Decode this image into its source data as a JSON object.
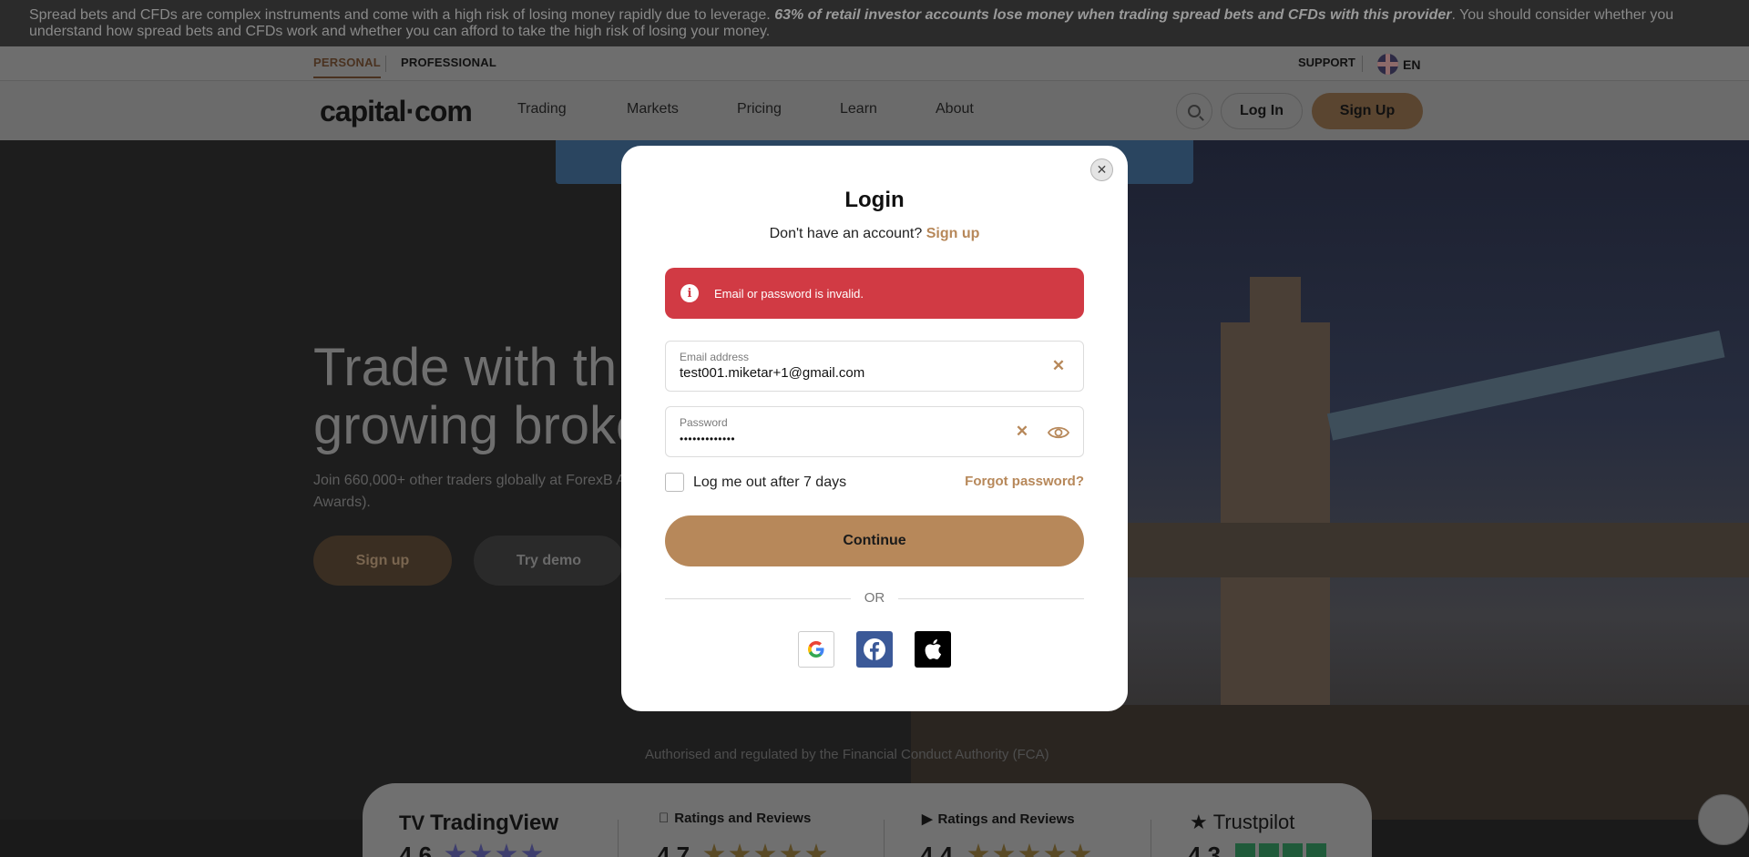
{
  "risk_banner": {
    "text_start": "Spread bets and CFDs are complex instruments and come with a high risk of losing money rapidly due to leverage. ",
    "text_bold": "63% of retail investor accounts lose money when trading spread bets and CFDs with this provider",
    "text_end": ". You should consider whether you understand how spread bets and CFDs work and whether you can afford to take the high risk of losing your money."
  },
  "subnav": {
    "personal": "PERSONAL",
    "professional": "PROFESSIONAL",
    "support": "SUPPORT",
    "language": "EN"
  },
  "nav": {
    "logo": "capital·com",
    "links": [
      "Trading",
      "Markets",
      "Pricing",
      "Learn",
      "About"
    ],
    "login": "Log In",
    "signup": "Sign Up"
  },
  "hero": {
    "title_line1": "Trade with th",
    "title_line2": "growing broke",
    "subtitle": "Join 660,000+ other traders globally at ForexB Annual Awards).",
    "signup": "Sign up",
    "demo": "Try demo",
    "regulation": "Authorised and regulated by the Financial Conduct Authority (FCA)"
  },
  "ratings": {
    "tradingview": "TradingView",
    "apple": "Ratings and Reviews",
    "google": "Ratings and Reviews",
    "trustpilot": "Trustpilot",
    "scores": [
      "4.6",
      "4.7",
      "4.4",
      "4.3"
    ]
  },
  "modal": {
    "title": "Login",
    "no_account": "Don't have an account?",
    "signup_link": "Sign up",
    "error": "Email or password is invalid.",
    "email_label": "Email address",
    "email_value": "test001.miketar+1@gmail.com",
    "password_label": "Password",
    "password_value": "•••••••••••••",
    "remember": "Log me out after 7 days",
    "forgot": "Forgot password?",
    "continue": "Continue",
    "or": "OR",
    "accent": "#b7885a",
    "error_color": "#d13a44"
  }
}
